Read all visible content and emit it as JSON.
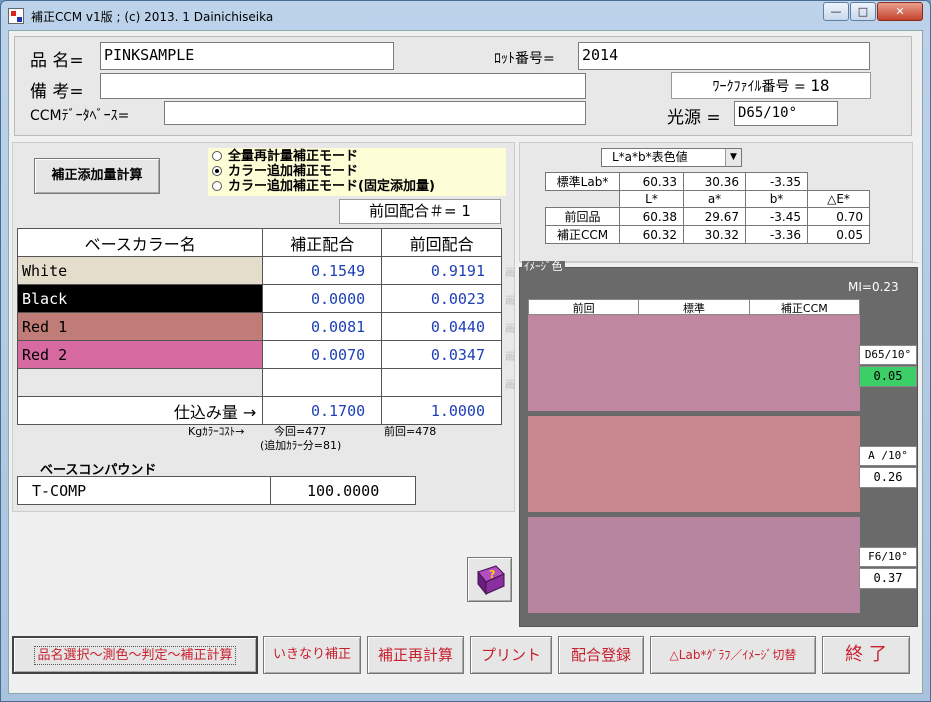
{
  "window": {
    "title": "補正CCM v1版 ; (c) 2013. 1 Dainichiseika",
    "minimize": "—",
    "maximize": "□",
    "close": "✕"
  },
  "header": {
    "product_label": "品 名=",
    "product_value": "PINKSAMPLE",
    "lot_label": "ﾛｯﾄ番号=",
    "lot_value": "2014",
    "remarks_label": "備 考=",
    "remarks_value": "",
    "workfile_label": "ﾜｰｸﾌｧｲﾙ番号 =",
    "workfile_value": "18",
    "ccm_db_label": "CCMﾃﾞｰﾀﾍﾞｰｽ=",
    "ccm_db_value": "",
    "light_label": "光源 =",
    "light_value": "D65/10°"
  },
  "calc_button": "補正添加量計算",
  "modes": [
    {
      "label": "全量再計量補正モード",
      "selected": false
    },
    {
      "label": "カラー追加補正モード",
      "selected": true
    },
    {
      "label": "カラー追加補正モード(固定添加量)",
      "selected": false
    }
  ],
  "prev_formula": "前回配合＃= 1",
  "grid": {
    "headers": [
      "ベースカラー名",
      "補正配合",
      "前回配合"
    ],
    "rows": [
      {
        "name": "White",
        "corr": "0.1549",
        "prev": "0.9191",
        "bg": "#e4ddcb",
        "fg": "#000000"
      },
      {
        "name": "Black",
        "corr": "0.0000",
        "prev": "0.0023",
        "bg": "#000000",
        "fg": "#ffffff"
      },
      {
        "name": "Red 1",
        "corr": "0.0081",
        "prev": "0.0440",
        "bg": "#c07c77",
        "fg": "#000000"
      },
      {
        "name": "Red 2",
        "corr": "0.0070",
        "prev": "0.0347",
        "bg": "#d86aa2",
        "fg": "#000000"
      },
      {
        "name": "",
        "corr": "",
        "prev": "",
        "bg": "#e8e8e8",
        "fg": "#000000"
      }
    ],
    "total_label": "仕込み量 →",
    "total_corr": "0.1700",
    "total_prev": "1.0000"
  },
  "cost": {
    "label": "Kgｶﾗｰｺｽﾄ→",
    "current": "今回=477",
    "previous": "前回=478",
    "additional": "(追加ｶﾗｰ分=81)"
  },
  "compound": {
    "title": "ベースコンパウンド",
    "name": "T-COMP",
    "value": "100.0000"
  },
  "side_marks": [
    "画",
    "画",
    "画",
    "画",
    "画"
  ],
  "lab": {
    "selector": "L*a*b*表色値",
    "std_label": "標準Lab*",
    "std": [
      "60.33",
      "30.36",
      "-3.35"
    ],
    "col_headers": [
      "L*",
      "a*",
      "b*",
      "△E*"
    ],
    "rows": [
      {
        "label": "前回品",
        "values": [
          "60.38",
          "29.67",
          "-3.45",
          "0.70"
        ]
      },
      {
        "label": "補正CCM",
        "values": [
          "60.32",
          "30.32",
          "-3.36",
          "0.05"
        ]
      }
    ]
  },
  "image": {
    "title": "ｲﾒｰｼﾞ色",
    "mi": "MI=0.23",
    "cols": [
      "前回",
      "標準",
      "補正CCM"
    ],
    "swatches": [
      {
        "illum": "D65/10°",
        "de": "0.05",
        "color": "#c088a0",
        "highlight": true
      },
      {
        "illum": "A /10°",
        "de": "0.26",
        "color": "#c8878f",
        "highlight": false
      },
      {
        "illum": "F6/10°",
        "de": "0.37",
        "color": "#b885a1",
        "highlight": false
      }
    ],
    "help_icon": "help-book-icon"
  },
  "buttons": {
    "measure": "品名選択～測色～判定～補正計算",
    "direct": "いきなり補正",
    "recalc": "補正再計算",
    "print": "プリント",
    "register": "配合登録",
    "graph": "△Lab*ｸﾞﾗﾌ／ｲﾒｰｼﾞ切替",
    "exit": "終 了"
  }
}
